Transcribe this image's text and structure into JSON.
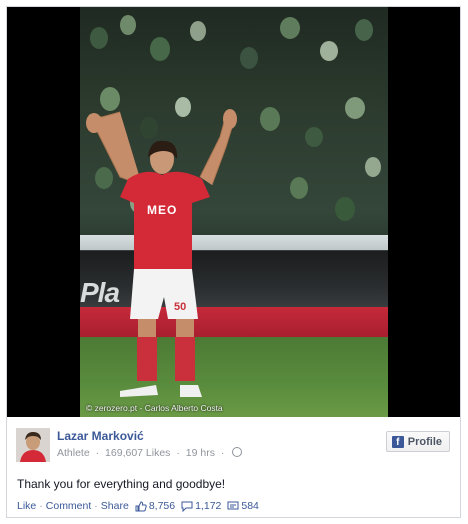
{
  "photo": {
    "credit": "© zerozero.pt - Carlos Alberto Costa",
    "jersey_sponsor": "MEO",
    "shorts_number": "50",
    "board_text": "Pla"
  },
  "post": {
    "author": "Lazar Marković",
    "category": "Athlete",
    "likes_text": "169,607 Likes",
    "time": "19 hrs",
    "message": "Thank you for everything and goodbye!",
    "profile_button": "Profile"
  },
  "actions": {
    "like": "Like",
    "comment": "Comment",
    "share": "Share",
    "like_count": "8,756",
    "comment_count": "1,172",
    "share_count": "584"
  },
  "colors": {
    "link": "#3b5998",
    "muted": "#90949c",
    "jersey": "#d42a37"
  },
  "icons": [
    "globe-icon",
    "facebook-logo-icon",
    "thumbs-up-icon",
    "comment-icon",
    "share-icon"
  ]
}
